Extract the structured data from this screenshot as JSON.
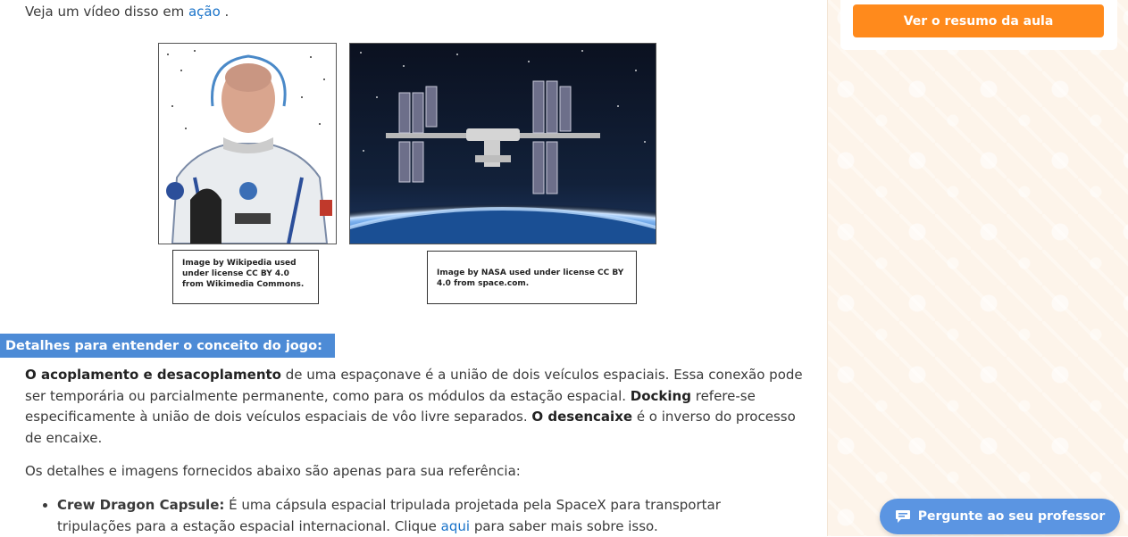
{
  "intro": {
    "text": "Veja um vídeo disso em ",
    "link": "ação",
    "suffix": " ."
  },
  "images": {
    "astronaut": {
      "alt": "astronaut-photo",
      "caption": "Image by Wikipedia used under license CC BY 4.0 from Wikimedia Commons."
    },
    "station": {
      "alt": "space-station-photo",
      "caption": "Image by NASA used under license CC BY 4.0 from space.com."
    }
  },
  "section": {
    "heading": "Detalhes para entender o conceito do jogo:"
  },
  "paragraph1": {
    "b1": "O acoplamento e desacoplamento",
    "t1": " de uma espaçonave é a união de dois veículos espaciais. Essa conexão pode ser temporária ou parcialmente permanente, como para os módulos da estação espacial. ",
    "b2": "Docking",
    "t2": " refere-se especificamente à união de dois veículos espaciais de vôo livre separados. ",
    "b3": "O desencaixe",
    "t3": " é o inverso do processo de encaixe."
  },
  "paragraph2": "Os detalhes e imagens fornecidos abaixo são apenas para sua referência:",
  "bullets": [
    {
      "title": "Crew Dragon Capsule:",
      "text": " É uma cápsula espacial tripulada projetada pela SpaceX para transportar tripulações para a estação espacial internacional. Clique ",
      "link": "aqui",
      "suffix": " para saber mais sobre isso."
    }
  ],
  "sidebar": {
    "summary_button": "Ver o resumo da aula",
    "chat_button": "Pergunte ao seu professor"
  },
  "colors": {
    "accent_orange": "#ff8a1c",
    "heading_blue": "#4d8bd6",
    "chat_blue": "#5b95e2",
    "link_blue": "#1a73c9"
  }
}
